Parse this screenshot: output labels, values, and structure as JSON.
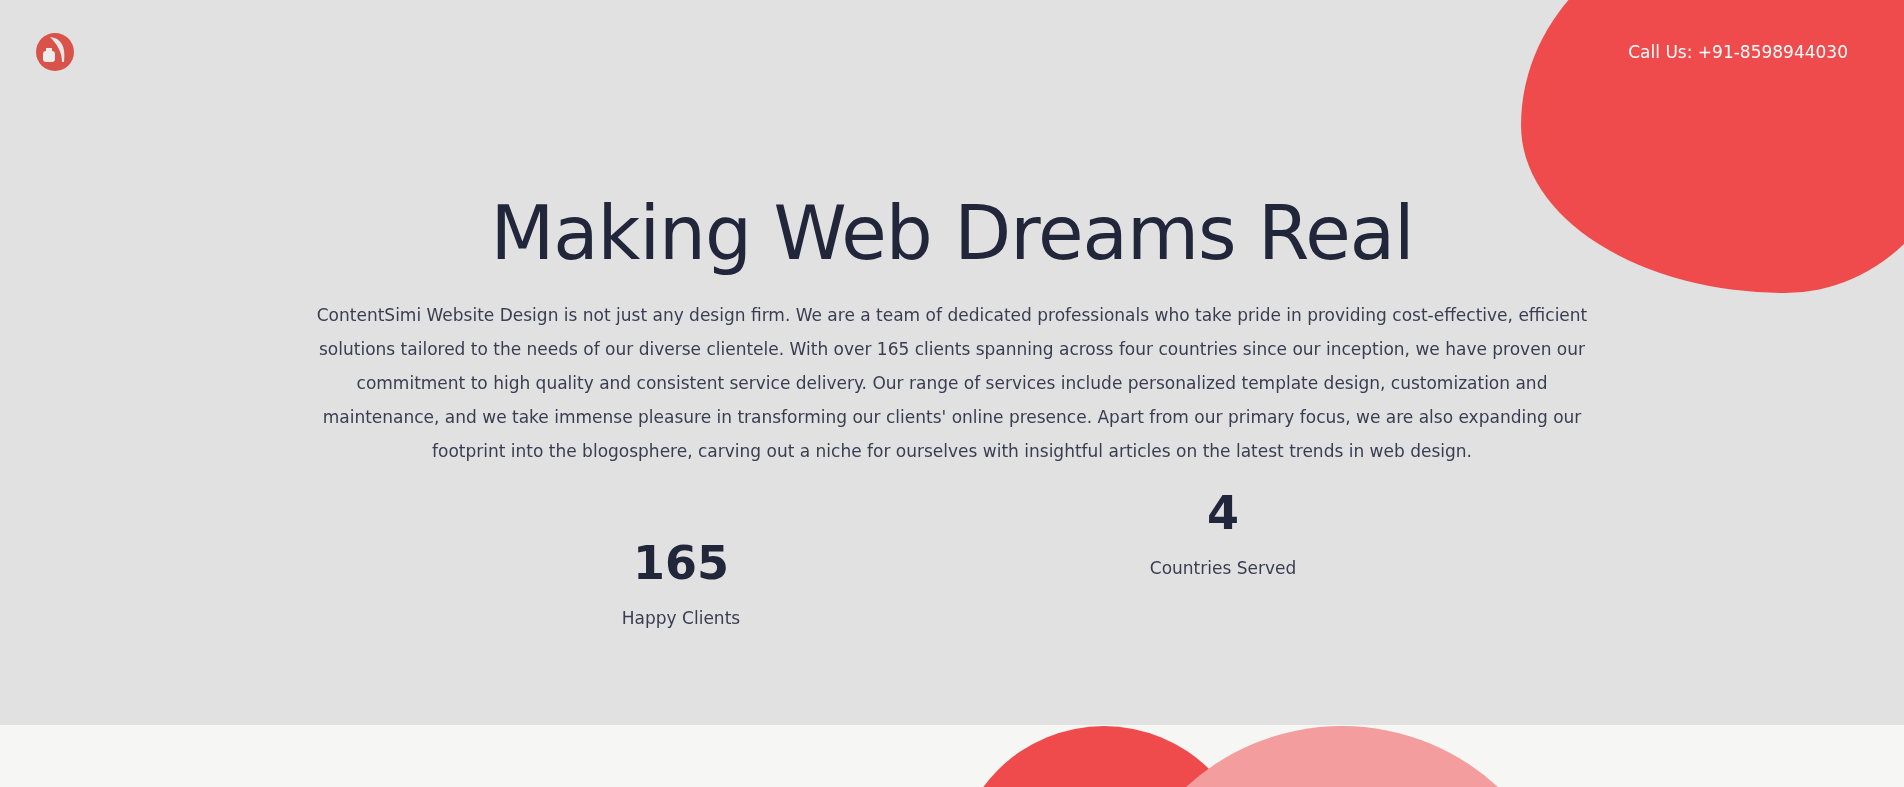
{
  "header": {
    "phone": "Call Us: +91-8598944030"
  },
  "hero": {
    "title": "Making Web Dreams Real",
    "description": "ContentSimi Website Design is not just any design firm. We are a team of dedicated professionals who take pride in providing cost-effective, efficient solutions tailored to the needs of our diverse clientele. With over 165 clients spanning across four countries since our inception, we have proven our commitment to high quality and consistent service delivery. Our range of services include personalized template design, customization and maintenance, and we take immense pleasure in transforming our clients' online presence. Apart from our primary focus, we are also expanding our footprint into the blogosphere, carving out a niche for ourselves with insightful articles on the latest trends in web design."
  },
  "stats": [
    {
      "value": "165",
      "label": "Happy Clients"
    },
    {
      "value": "4",
      "label": "Countries Served"
    }
  ]
}
